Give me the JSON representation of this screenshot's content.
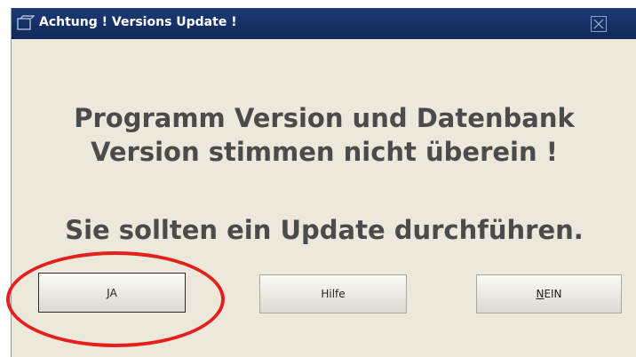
{
  "window": {
    "title": "Achtung ! Versions Update !",
    "close_icon": "close-icon",
    "title_icon": "window-icon"
  },
  "message": {
    "line1": "Programm Version und Datenbank",
    "line2": "Version stimmen nicht überein !",
    "line3": "Sie sollten ein Update durchführen."
  },
  "buttons": {
    "yes": {
      "mnemonic": "J",
      "rest": "A"
    },
    "help": {
      "label": "Hilfe"
    },
    "no": {
      "mnemonic": "N",
      "rest": "EIN"
    }
  },
  "colors": {
    "titlebar": "#143063",
    "dialog_bg": "#ece9dc",
    "message_text": "#4b4b4b",
    "highlight": "#e3201b"
  }
}
